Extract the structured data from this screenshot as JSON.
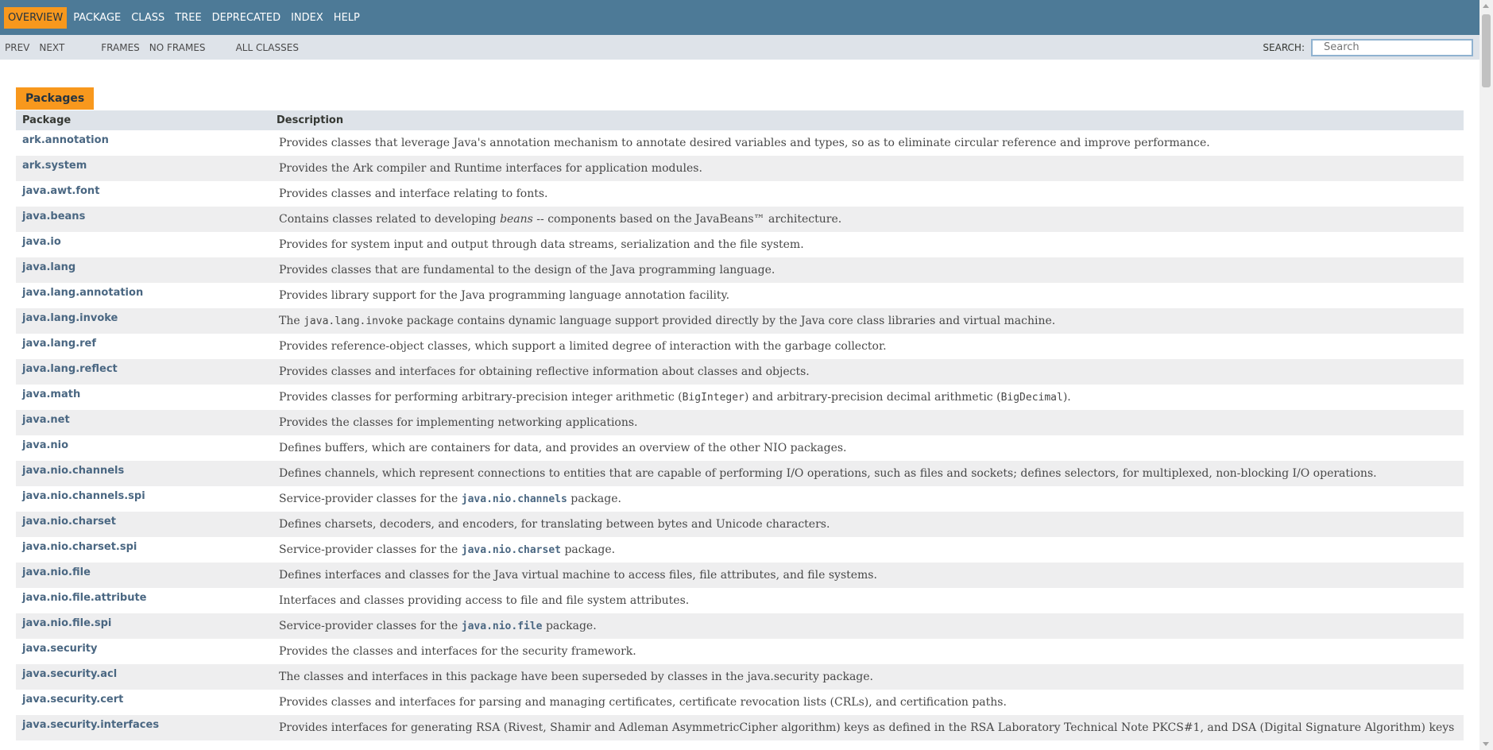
{
  "nav": {
    "items": [
      "Overview",
      "Package",
      "Class",
      "Tree",
      "Deprecated",
      "Index",
      "Help"
    ],
    "active": "Overview"
  },
  "subnav": {
    "prev": "PREV",
    "next": "NEXT",
    "frames": "FRAMES",
    "no_frames": "NO FRAMES",
    "all_classes": "ALL CLASSES",
    "search_label": "SEARCH:",
    "search_placeholder": "Search"
  },
  "table": {
    "caption": "Packages",
    "headers": [
      "Package",
      "Description"
    ],
    "rows": [
      {
        "pkg": "ark.annotation",
        "desc": [
          {
            "t": "Provides classes that leverage Java's annotation mechanism to annotate desired variables and types, so as to eliminate circular reference and improve performance."
          }
        ]
      },
      {
        "pkg": "ark.system",
        "desc": [
          {
            "t": "Provides the Ark compiler and Runtime interfaces for application modules."
          }
        ]
      },
      {
        "pkg": "java.awt.font",
        "desc": [
          {
            "t": "Provides classes and interface relating to fonts."
          }
        ]
      },
      {
        "pkg": "java.beans",
        "desc": [
          {
            "t": "Contains classes related to developing "
          },
          {
            "t": "beans",
            "s": "em"
          },
          {
            "t": " -- components based on the JavaBeans™ architecture."
          }
        ]
      },
      {
        "pkg": "java.io",
        "desc": [
          {
            "t": "Provides for system input and output through data streams, serialization and the file system."
          }
        ]
      },
      {
        "pkg": "java.lang",
        "desc": [
          {
            "t": "Provides classes that are fundamental to the design of the Java programming language."
          }
        ]
      },
      {
        "pkg": "java.lang.annotation",
        "desc": [
          {
            "t": "Provides library support for the Java programming language annotation facility."
          }
        ]
      },
      {
        "pkg": "java.lang.invoke",
        "desc": [
          {
            "t": "The "
          },
          {
            "t": "java.lang.invoke",
            "s": "mono"
          },
          {
            "t": " package contains dynamic language support provided directly by the Java core class libraries and virtual machine."
          }
        ]
      },
      {
        "pkg": "java.lang.ref",
        "desc": [
          {
            "t": "Provides reference-object classes, which support a limited degree of interaction with the garbage collector."
          }
        ]
      },
      {
        "pkg": "java.lang.reflect",
        "desc": [
          {
            "t": "Provides classes and interfaces for obtaining reflective information about classes and objects."
          }
        ]
      },
      {
        "pkg": "java.math",
        "desc": [
          {
            "t": "Provides classes for performing arbitrary-precision integer arithmetic ("
          },
          {
            "t": "BigInteger",
            "s": "mono"
          },
          {
            "t": ") and arbitrary-precision decimal arithmetic ("
          },
          {
            "t": "BigDecimal",
            "s": "mono"
          },
          {
            "t": ")."
          }
        ]
      },
      {
        "pkg": "java.net",
        "desc": [
          {
            "t": "Provides the classes for implementing networking applications."
          }
        ]
      },
      {
        "pkg": "java.nio",
        "desc": [
          {
            "t": "Defines buffers, which are containers for data, and provides an overview of the other NIO packages."
          }
        ]
      },
      {
        "pkg": "java.nio.channels",
        "desc": [
          {
            "t": "Defines channels, which represent connections to entities that are capable of performing I/O operations, such as files and sockets; defines selectors, for multiplexed, non-blocking I/O operations."
          }
        ]
      },
      {
        "pkg": "java.nio.channels.spi",
        "desc": [
          {
            "t": "Service-provider classes for the "
          },
          {
            "t": "java.nio.channels",
            "s": "monob"
          },
          {
            "t": " package."
          }
        ]
      },
      {
        "pkg": "java.nio.charset",
        "desc": [
          {
            "t": "Defines charsets, decoders, and encoders, for translating between bytes and Unicode characters."
          }
        ]
      },
      {
        "pkg": "java.nio.charset.spi",
        "desc": [
          {
            "t": "Service-provider classes for the "
          },
          {
            "t": "java.nio.charset",
            "s": "monob"
          },
          {
            "t": " package."
          }
        ]
      },
      {
        "pkg": "java.nio.file",
        "desc": [
          {
            "t": "Defines interfaces and classes for the Java virtual machine to access files, file attributes, and file systems."
          }
        ]
      },
      {
        "pkg": "java.nio.file.attribute",
        "desc": [
          {
            "t": "Interfaces and classes providing access to file and file system attributes."
          }
        ]
      },
      {
        "pkg": "java.nio.file.spi",
        "desc": [
          {
            "t": "Service-provider classes for the "
          },
          {
            "t": "java.nio.file",
            "s": "monob"
          },
          {
            "t": " package."
          }
        ]
      },
      {
        "pkg": "java.security",
        "desc": [
          {
            "t": "Provides the classes and interfaces for the security framework."
          }
        ]
      },
      {
        "pkg": "java.security.acl",
        "desc": [
          {
            "t": "The classes and interfaces in this package have been superseded by classes in the java.security package."
          }
        ]
      },
      {
        "pkg": "java.security.cert",
        "desc": [
          {
            "t": "Provides classes and interfaces for parsing and managing certificates, certificate revocation lists (CRLs), and certification paths."
          }
        ]
      },
      {
        "pkg": "java.security.interfaces",
        "desc": [
          {
            "t": "Provides interfaces for generating RSA (Rivest, Shamir and Adleman AsymmetricCipher algorithm) keys as defined in the RSA Laboratory Technical Note PKCS#1, and DSA (Digital Signature Algorithm) keys"
          }
        ]
      }
    ]
  },
  "colors": {
    "nav_bg": "#4d7a97",
    "nav_active": "#f8981d",
    "subnav_bg": "#dee3e9",
    "link": "#4a6782",
    "row_alt": "#eeeeef"
  }
}
